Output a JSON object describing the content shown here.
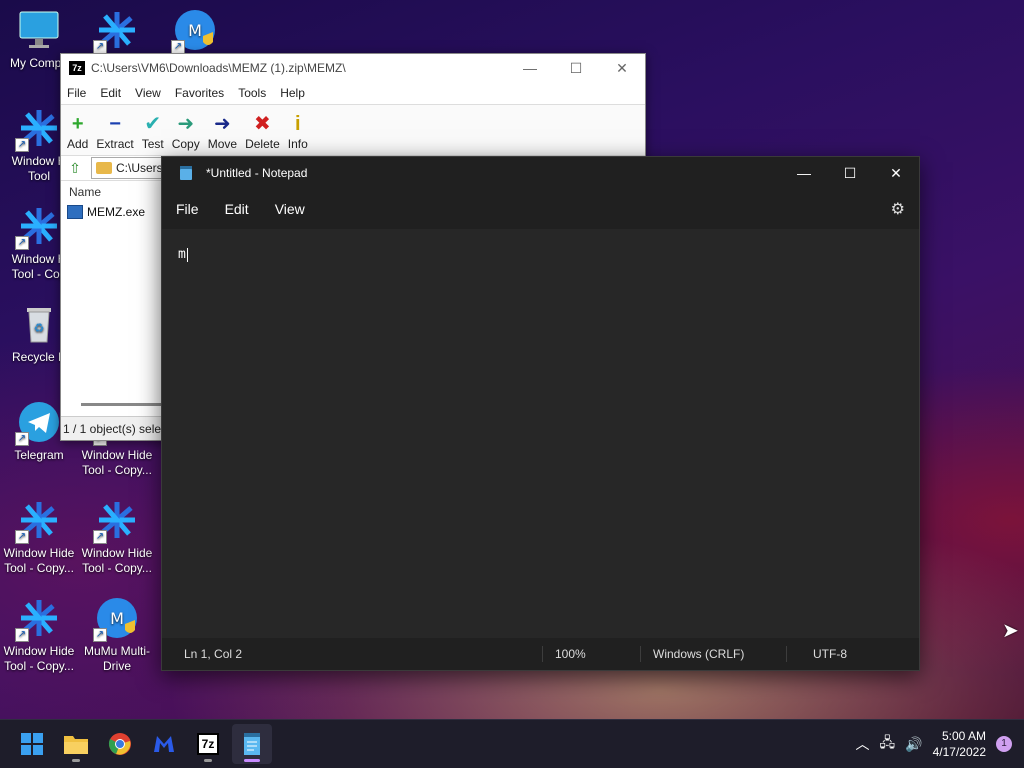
{
  "desktop": {
    "icons": [
      {
        "label": "My Compu"
      },
      {
        "label": ""
      },
      {
        "label": ""
      },
      {
        "label": "Window H Tool"
      },
      {
        "label": "Window H Tool - Cop"
      },
      {
        "label": "Recycle B"
      },
      {
        "label": "Telegram"
      },
      {
        "label": "Window Hide Tool - Copy..."
      },
      {
        "label": "Window Hide Tool - Copy..."
      },
      {
        "label": "Window Hide Tool - Copy..."
      },
      {
        "label": "Window Hide Tool - Copy..."
      },
      {
        "label": "MuMu Multi-Drive"
      }
    ]
  },
  "sevenzip": {
    "app_icon": "7z",
    "title": "C:\\Users\\VM6\\Downloads\\MEMZ (1).zip\\MEMZ\\",
    "menu": [
      "File",
      "Edit",
      "View",
      "Favorites",
      "Tools",
      "Help"
    ],
    "toolbar": [
      {
        "label": "Add",
        "glyph": "+",
        "color": "#2ea82e"
      },
      {
        "label": "Extract",
        "glyph": "−",
        "color": "#1a3fb0"
      },
      {
        "label": "Test",
        "glyph": "✔",
        "color": "#2ab0b0"
      },
      {
        "label": "Copy",
        "glyph": "➜",
        "color": "#2a9a7a"
      },
      {
        "label": "Move",
        "glyph": "➜",
        "color": "#1a2a8a"
      },
      {
        "label": "Delete",
        "glyph": "✖",
        "color": "#d02020"
      },
      {
        "label": "Info",
        "glyph": "i",
        "color": "#c8a000"
      }
    ],
    "address": "C:\\Users",
    "column_header": "Name",
    "files": [
      "MEMZ.exe"
    ],
    "status": "1 / 1 object(s) selec"
  },
  "notepad": {
    "title": "*Untitled - Notepad",
    "menu": [
      "File",
      "Edit",
      "View"
    ],
    "content": "m",
    "status": {
      "position": "Ln 1, Col 2",
      "zoom": "100%",
      "line_ending": "Windows (CRLF)",
      "encoding": "UTF-8"
    }
  },
  "taskbar": {
    "apps": [
      "start-icon",
      "file-explorer-icon",
      "chrome-icon",
      "malwarebytes-icon",
      "7zip-icon",
      "notepad-icon"
    ],
    "sevenzip_label": "7z",
    "time": "5:00 AM",
    "date": "4/17/2022",
    "notification_count": "1"
  },
  "colors": {
    "notepad_bg": "#272727",
    "taskbar_bg": "#1e1d2a",
    "active_indicator": "#c88bff"
  }
}
